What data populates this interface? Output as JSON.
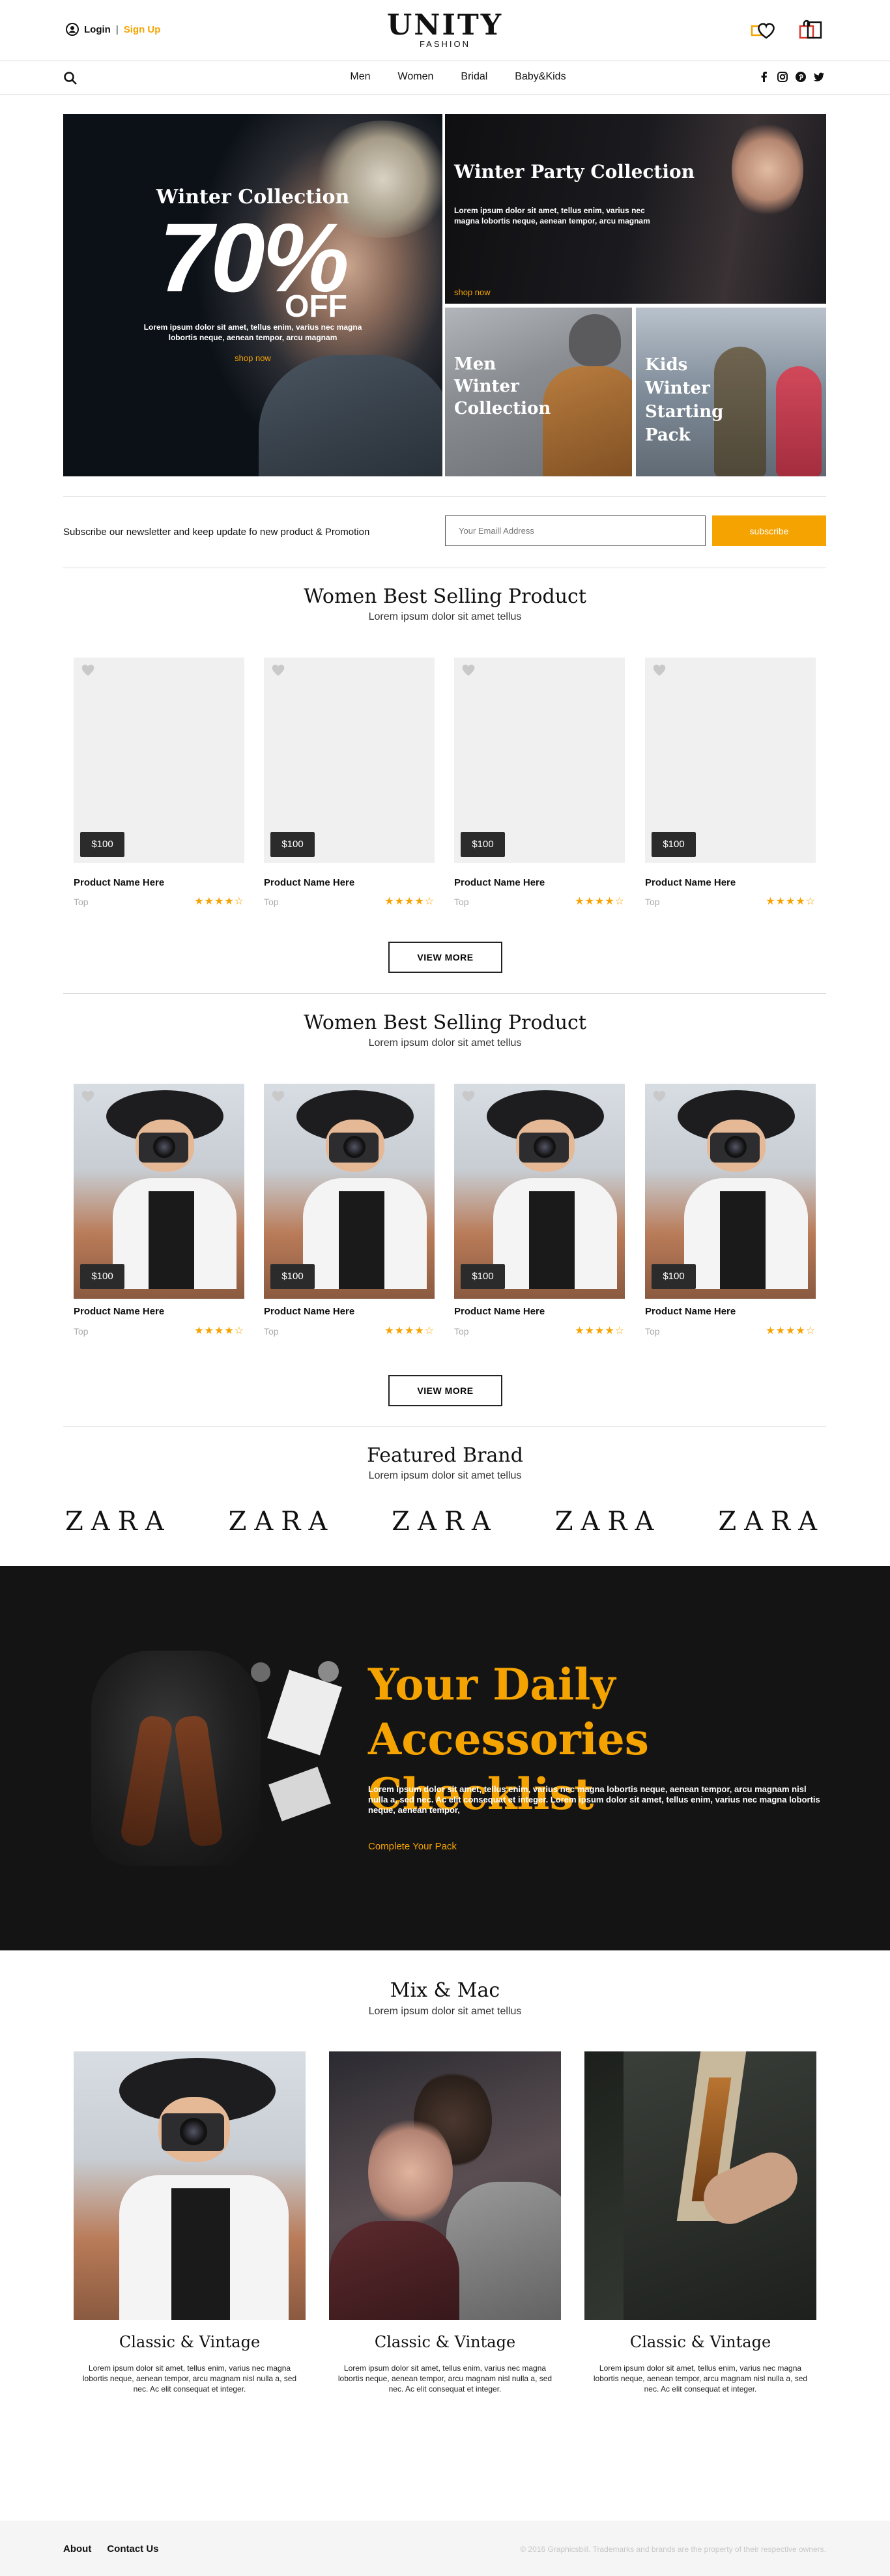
{
  "header": {
    "login": "Login",
    "separator": "|",
    "signup": "Sign Up",
    "logo_title": "UNITY",
    "logo_subtitle": "FASHION",
    "icons": [
      "wishlist-heart-icon",
      "shopping-bag-icon"
    ]
  },
  "nav": {
    "items": [
      "Men",
      "Women",
      "Bridal",
      "Baby&Kids"
    ],
    "social": [
      "facebook-icon",
      "instagram-icon",
      "pinterest-icon",
      "twitter-icon"
    ]
  },
  "hero": {
    "winter": {
      "title": "Winter Collection",
      "percent": "70%",
      "off": "OFF",
      "desc": "Lorem ipsum dolor sit amet, tellus enim, varius nec magna lobortis neque, aenean tempor, arcu magnam",
      "cta": "shop now"
    },
    "party": {
      "title": "Winter Party Collection",
      "desc": "Lorem ipsum dolor sit amet, tellus enim, varius nec magna lobortis neque, aenean tempor, arcu magnam",
      "cta": "shop now"
    },
    "men": {
      "title": "Men Winter Collection"
    },
    "kids": {
      "title": "Kids Winter Starting Pack"
    }
  },
  "newsletter": {
    "text": "Subscribe our newsletter and keep update fo new product & Promotion",
    "placeholder": "Your Emaill Address",
    "button": "subscribe"
  },
  "section1": {
    "title": "Women Best Selling Product",
    "subtitle": "Lorem ipsum dolor sit amet tellus",
    "products": [
      {
        "price": "$100",
        "name": "Product Name Here",
        "category": "Top",
        "stars": "★★★★☆",
        "rating": 4
      },
      {
        "price": "$100",
        "name": "Product Name Here",
        "category": "Top",
        "stars": "★★★★☆",
        "rating": 4
      },
      {
        "price": "$100",
        "name": "Product Name Here",
        "category": "Top",
        "stars": "★★★★☆",
        "rating": 4
      },
      {
        "price": "$100",
        "name": "Product Name Here",
        "category": "Top",
        "stars": "★★★★☆",
        "rating": 4
      }
    ],
    "view_more": "VIEW MORE"
  },
  "section2": {
    "title": "Women Best Selling Product",
    "subtitle": "Lorem ipsum dolor sit amet tellus",
    "products": [
      {
        "price": "$100",
        "name": "Product Name Here",
        "category": "Top",
        "stars": "★★★★☆",
        "rating": 4
      },
      {
        "price": "$100",
        "name": "Product Name Here",
        "category": "Top",
        "stars": "★★★★☆",
        "rating": 4
      },
      {
        "price": "$100",
        "name": "Product Name Here",
        "category": "Top",
        "stars": "★★★★☆",
        "rating": 4
      },
      {
        "price": "$100",
        "name": "Product Name Here",
        "category": "Top",
        "stars": "★★★★☆",
        "rating": 4
      }
    ],
    "view_more": "VIEW MORE"
  },
  "brands": {
    "title": "Featured Brand",
    "subtitle": "Lorem ipsum dolor sit amet tellus",
    "items": [
      "ZARA",
      "ZARA",
      "ZARA",
      "ZARA",
      "ZARA"
    ]
  },
  "promo": {
    "title": "Your Daily Accessories Checklist",
    "desc": "Lorem ipsum dolor sit amet, tellus enim, varius nec magna lobortis neque, aenean tempor, arcu magnam nisl nulla a, sed nec. Ac elit consequat et integer. Lorem ipsum dolor sit amet, tellus enim, varius nec magna lobortis neque, aenean tempor,",
    "cta": "Complete Your Pack",
    "accent": "#f5a300"
  },
  "mix": {
    "title": "Mix & Mac",
    "subtitle": "Lorem ipsum dolor sit amet tellus",
    "items": [
      {
        "caption": "Classic & Vintage",
        "desc": "Lorem ipsum dolor sit amet, tellus enim, varius nec magna lobortis neque, aenean tempor, arcu magnam nisl nulla a, sed nec. Ac elit consequat et integer."
      },
      {
        "caption": "Classic & Vintage",
        "desc": "Lorem ipsum dolor sit amet, tellus enim, varius nec magna lobortis neque, aenean tempor, arcu magnam nisl nulla a, sed nec. Ac elit consequat et integer."
      },
      {
        "caption": "Classic & Vintage",
        "desc": "Lorem ipsum dolor sit amet, tellus enim, varius nec magna lobortis neque, aenean tempor, arcu magnam nisl nulla a, sed nec. Ac elit consequat et integer."
      }
    ]
  },
  "footer": {
    "links": [
      "About",
      "Contact Us"
    ],
    "copyright": "© 2016 Graphicsbill. Trademarks and brands are the property of their respective owners."
  }
}
